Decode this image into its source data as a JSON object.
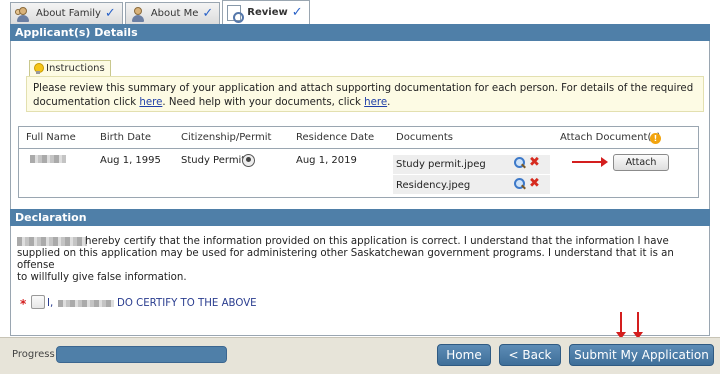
{
  "tabs": [
    {
      "label": "About Family",
      "checked": true,
      "icon": "family-icon"
    },
    {
      "label": "About Me",
      "checked": true,
      "icon": "person-icon"
    },
    {
      "label": "Review",
      "checked": true,
      "icon": "review-icon",
      "active": true
    }
  ],
  "applicants": {
    "title": "Applicant(s) Details",
    "instructions_label": "Instructions",
    "instructions_text_1": "Please review this summary of your application and attach supporting documentation for each person. For details of the required documentation click ",
    "instructions_link_1": "here",
    "instructions_text_2": ". Need help with your documents, click ",
    "instructions_link_2": "here",
    "instructions_text_3": ".",
    "columns": {
      "full_name": "Full Name",
      "birth_date": "Birth Date",
      "citizenship": "Citizenship/Permit",
      "residence_date": "Residence Date",
      "documents": "Documents",
      "attach": "Attach Document(s)"
    },
    "row": {
      "birth_date": "Aug 1, 1995",
      "citizenship": "Study Permit",
      "residence_date": "Aug 1, 2019",
      "documents": [
        "Study permit.jpeg",
        "Residency.jpeg"
      ],
      "attach_label": "Attach"
    }
  },
  "declaration": {
    "title": "Declaration",
    "text_line1_rest": "hereby certify that the information provided on this application is correct. I understand that the information I have",
    "text_line2": "supplied on this application may be used for administering other Saskatchewan government programs. I understand that it is an offense",
    "text_line3": "to willfully give false information.",
    "asterisk": "*",
    "certify_prefix": "I,",
    "certify_suffix": "DO CERTIFY TO THE ABOVE"
  },
  "footer": {
    "progress_label": "Progress",
    "progress_fraction": 1.0,
    "home_label": "Home",
    "back_label": "< Back",
    "submit_label": "Submit My Application"
  },
  "colors": {
    "accent": "#4f7fa8",
    "annotation_red": "#d41e1e"
  }
}
